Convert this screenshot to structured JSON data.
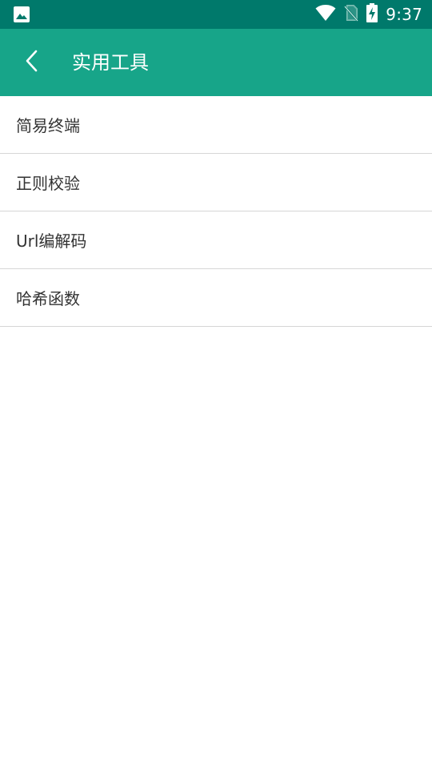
{
  "status_bar": {
    "time": "9:37",
    "icons": [
      "image-notification-icon",
      "wifi-icon",
      "no-sim-icon",
      "battery-charging-icon"
    ]
  },
  "app_bar": {
    "title": "实用工具",
    "back_icon": "back-chevron-icon"
  },
  "tools": {
    "items": [
      {
        "label": "简易终端"
      },
      {
        "label": "正则校验"
      },
      {
        "label": "Url编解码"
      },
      {
        "label": "哈希函数"
      }
    ]
  },
  "colors": {
    "status_bar": "#00796b",
    "app_bar": "#17a589",
    "divider": "#d6d6d6",
    "text": "#333333"
  }
}
